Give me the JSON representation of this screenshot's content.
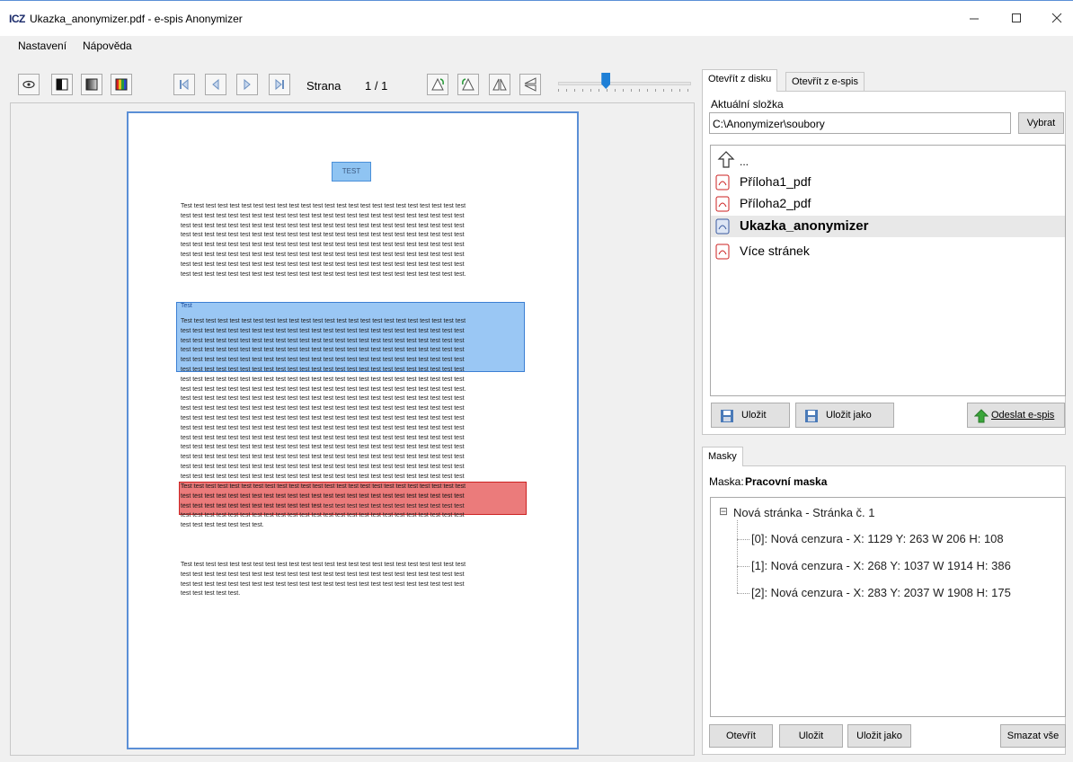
{
  "window": {
    "logo": "ICZ",
    "title": "Ukazka_anonymizer.pdf - e-spis Anonymizer",
    "controls": [
      "minimize-icon",
      "maximize-icon",
      "close-icon"
    ]
  },
  "menu": {
    "items": [
      "Nastavení",
      "Nápověda"
    ]
  },
  "toolbar": {
    "view_buttons": [
      "eye-icon",
      "black-white-icon",
      "grayscale-icon",
      "color-icon"
    ],
    "nav_buttons": [
      "first-page-icon",
      "prev-page-icon",
      "next-page-icon",
      "last-page-icon"
    ],
    "page_label": "Strana",
    "page_indicator": "1 / 1",
    "tool_buttons": [
      "rotate-left-icon",
      "rotate-right-icon",
      "flip-horizontal-icon",
      "flip-vertical-icon"
    ],
    "zoom_level": 0.36
  },
  "document": {
    "header_box": "TEST",
    "paragraph1": [
      "Test test test test test test test test test test test test test test test test test test test test test test test test",
      "test test test test test test test test test test test test test test test test test test test test test test test test",
      "test test test test test test test test test test test test test test test test test test test test test test test test",
      "test test test test test test test test test test test test test test test test test test test test test test test test",
      "test test test test test test test test test test test test test test test test test test test test test test test test",
      "test test test test test test test test test test test test test test test test test test test test test test test test",
      "test test test test test test test test test test test test test test test test test test test test test test test test",
      "test test test test test test test test test test test test test test test test test test test test test test test test."
    ],
    "blue_mask_label": "Test",
    "paragraph2": [
      "Test test test test test test test test test test test test test test test test test test test test test test test test",
      "test test test test test test test test test test test test test test test test test test test test test test test test",
      "test test test test test test test test test test test test test test test test test test test test test test test test",
      "test test test test test test test test test test test test test test test test test test test test test test test test",
      "test test test test test test test test test test test test test test test test test test test test test test test test",
      "test test test test test test test test test test test test test test test test test test test test test test test test",
      "test test test test test test test test test test test test test test test test test test test test test test test test",
      "test test test test test test test test test test test test test test test test test test test test test test test test.",
      "test test test test test test test test test test test test test test test test test test test test test test test test",
      "test test test test test test test test test test test test test test test test test test test test test test test test",
      "test test test test test test test test test test test test test test test test test test test test test test test test",
      "test test test test test test test test test test test test test test test test test test test test test test test test",
      "test test test test test test test test test test test test test test test test test test test test test test test test",
      "test test test test test test test test test test test test test test test test test test test test test test test test",
      "test test test test test test test test test test test test test test test test test test test test test test test test",
      "test test test test test test test test test test test test test test test test test test test test test test test test",
      "test test test test test test test test test test test test test test test test test test test test test test test test",
      "test test test test test test test test test test test test test test test test test test test test test test test test",
      "test test test test test test test test test test test test test test test test test test test test test test test test",
      "test test test test test test test test test test test test."
    ],
    "paragraph3": [
      "Test test test test test test test test test test test test test test test test test test test test test test test test",
      "test test test test test test test test test test test test test test test test test test test test test test test test",
      "test test test test test test test test test test test test test test test test test test test test test test test test",
      "test test test test test test test test test test test test test test test test test test test test test test test test",
      "test test test test test test test."
    ],
    "paragraph4": [
      "Test test test test test test test test test test test test test test test test test test test test test test test test",
      "test test test test test test test test test test test test test test test test test test test test test test test test",
      "test test test test test test test test test test test test test test test test test test test test test test test test",
      "test test test test test."
    ]
  },
  "open_panel": {
    "tabs": [
      "Otevřít z disku",
      "Otevřít z e-spis"
    ],
    "folder_label": "Aktuální složka",
    "folder_path": "C:\\Anonymizer\\soubory",
    "browse_button": "Vybrat",
    "up_label": "...",
    "files": [
      {
        "name": "Příloha1_pdf",
        "selected": false
      },
      {
        "name": "Příloha2_pdf",
        "selected": false
      },
      {
        "name": "Ukazka_anonymizer",
        "selected": true
      },
      {
        "name": "Více stránek",
        "selected": false
      }
    ],
    "save_button": "Uložit",
    "save_as_button": "Uložit jako",
    "send_button": "Odeslat e-spis"
  },
  "masks_panel": {
    "tab": "Masky",
    "mask_label": "Maska:",
    "mask_name": "Pracovní maska",
    "tree_root_toggle": "⊟",
    "tree_root": "Nová stránka - Stránka č. 1",
    "tree_items": [
      "[0]: Nová cenzura - X: 1129 Y: 263 W 206 H: 108",
      "[1]: Nová cenzura - X: 268 Y: 1037 W 1914 H: 386",
      "[2]: Nová cenzura - X: 283 Y: 2037 W 1908 H: 175"
    ],
    "buttons": {
      "open": "Otevřít",
      "save": "Uložit",
      "save_as": "Uložit jako",
      "delete_all": "Smazat vše"
    }
  }
}
